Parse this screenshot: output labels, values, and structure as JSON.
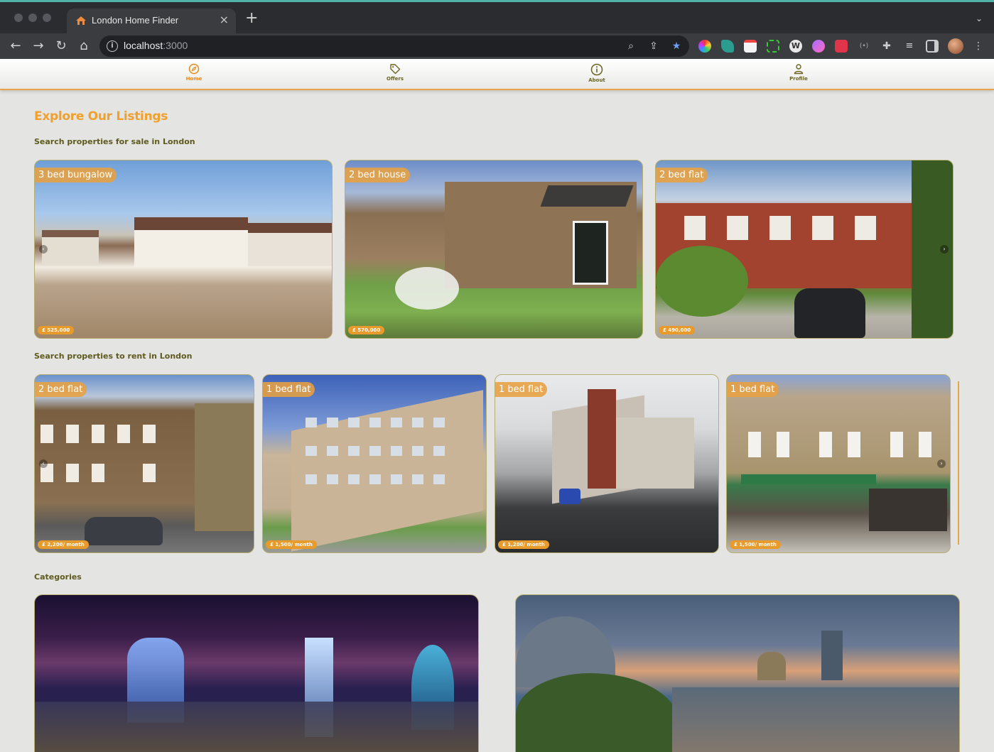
{
  "browser": {
    "tab_title": "London Home Finder",
    "tab_close": "×",
    "new_tab": "+",
    "url_host": "localhost",
    "url_port": ":3000"
  },
  "nav": {
    "items": [
      {
        "label": "Home",
        "icon": "compass-icon",
        "active": true
      },
      {
        "label": "Offers",
        "icon": "tag-icon",
        "active": false
      },
      {
        "label": "About",
        "icon": "info-icon",
        "active": false
      },
      {
        "label": "Profile",
        "icon": "user-icon",
        "active": false
      }
    ]
  },
  "main": {
    "heading": "Explore Our Listings",
    "sale_title": "Search properties for sale in London",
    "rent_title": "Search properties to rent in London",
    "categories_title": "Categories"
  },
  "sale_listings": [
    {
      "type": "3 bed bungalow",
      "price": "£ 525,000"
    },
    {
      "type": "2 bed house",
      "price": "£ 570,000"
    },
    {
      "type": "2 bed flat",
      "price": "£ 490,000"
    }
  ],
  "rent_listings": [
    {
      "type": "2 bed flat",
      "price": "£ 2,200/ month"
    },
    {
      "type": "1 bed flat",
      "price": "£ 1,500/ month"
    },
    {
      "type": "1 bed flat",
      "price": "£ 1,200/ month"
    },
    {
      "type": "1 bed flat",
      "price": "£ 1,500/ month"
    }
  ],
  "colors": {
    "accent": "#e89a2a",
    "heading": "#f0a02c",
    "section_title": "#5f5a1e",
    "page_bg": "#e4e4e2"
  }
}
